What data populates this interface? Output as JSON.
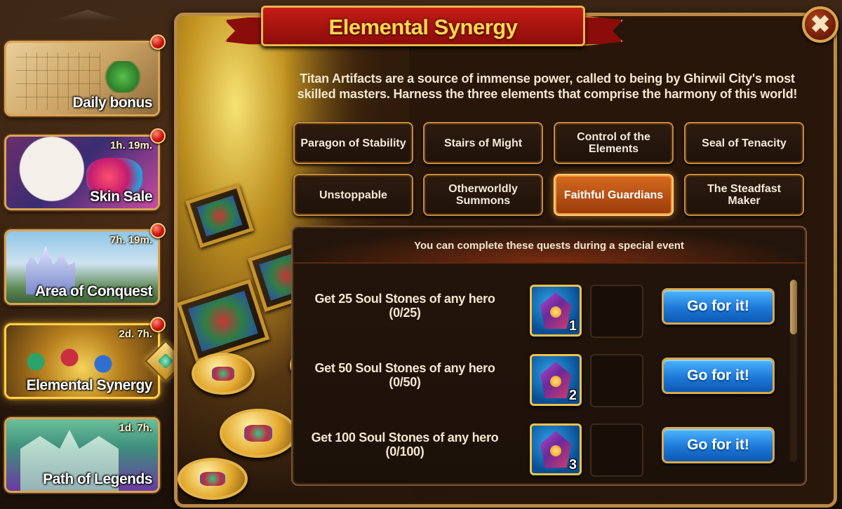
{
  "title": "Elemental Synergy",
  "description": "Titan Artifacts are a source of immense power, called to being by Ghirwil City's most skilled masters. Harness the three elements that comprise the harmony of this world!",
  "close_label": "✖",
  "sidebar": {
    "items": [
      {
        "label": "Daily bonus",
        "timer": "",
        "icon": "calendar-art"
      },
      {
        "label": "Skin Sale",
        "timer": "1h. 19m.",
        "icon": "mask-art"
      },
      {
        "label": "Area of Conquest",
        "timer": "7h. 19m.",
        "icon": "castle-art"
      },
      {
        "label": "Elemental Synergy",
        "timer": "2d. 7h.",
        "icon": "artifacts-art"
      },
      {
        "label": "Path of Legends",
        "timer": "1d. 7h.",
        "icon": "legends-art"
      }
    ]
  },
  "tabs": [
    {
      "label": "Paragon of Stability"
    },
    {
      "label": "Stairs of Might"
    },
    {
      "label": "Control of the Elements"
    },
    {
      "label": "Seal of Tenacity"
    },
    {
      "label": "Unstoppable"
    },
    {
      "label": "Otherworldly Summons"
    },
    {
      "label": "Faithful Guardians"
    },
    {
      "label": "The Steadfast Maker"
    }
  ],
  "selected_tab": "Faithful Guardians",
  "quests": {
    "note": "You can complete these quests during a special event",
    "rows": [
      {
        "text": "Get 25 Soul Stones of any hero",
        "progress": "(0/25)",
        "reward_count": "1",
        "button": "Go for it!"
      },
      {
        "text": "Get 50 Soul Stones of any hero",
        "progress": "(0/50)",
        "reward_count": "2",
        "button": "Go for it!"
      },
      {
        "text": "Get 100 Soul Stones of any hero",
        "progress": "(0/100)",
        "reward_count": "3",
        "button": "Go for it!"
      }
    ]
  },
  "colors": {
    "accent_gold": "#ffd84e",
    "ribbon_red": "#c41c15",
    "button_blue": "#1d78d8",
    "selected_tab_orange": "#d66a1f"
  }
}
